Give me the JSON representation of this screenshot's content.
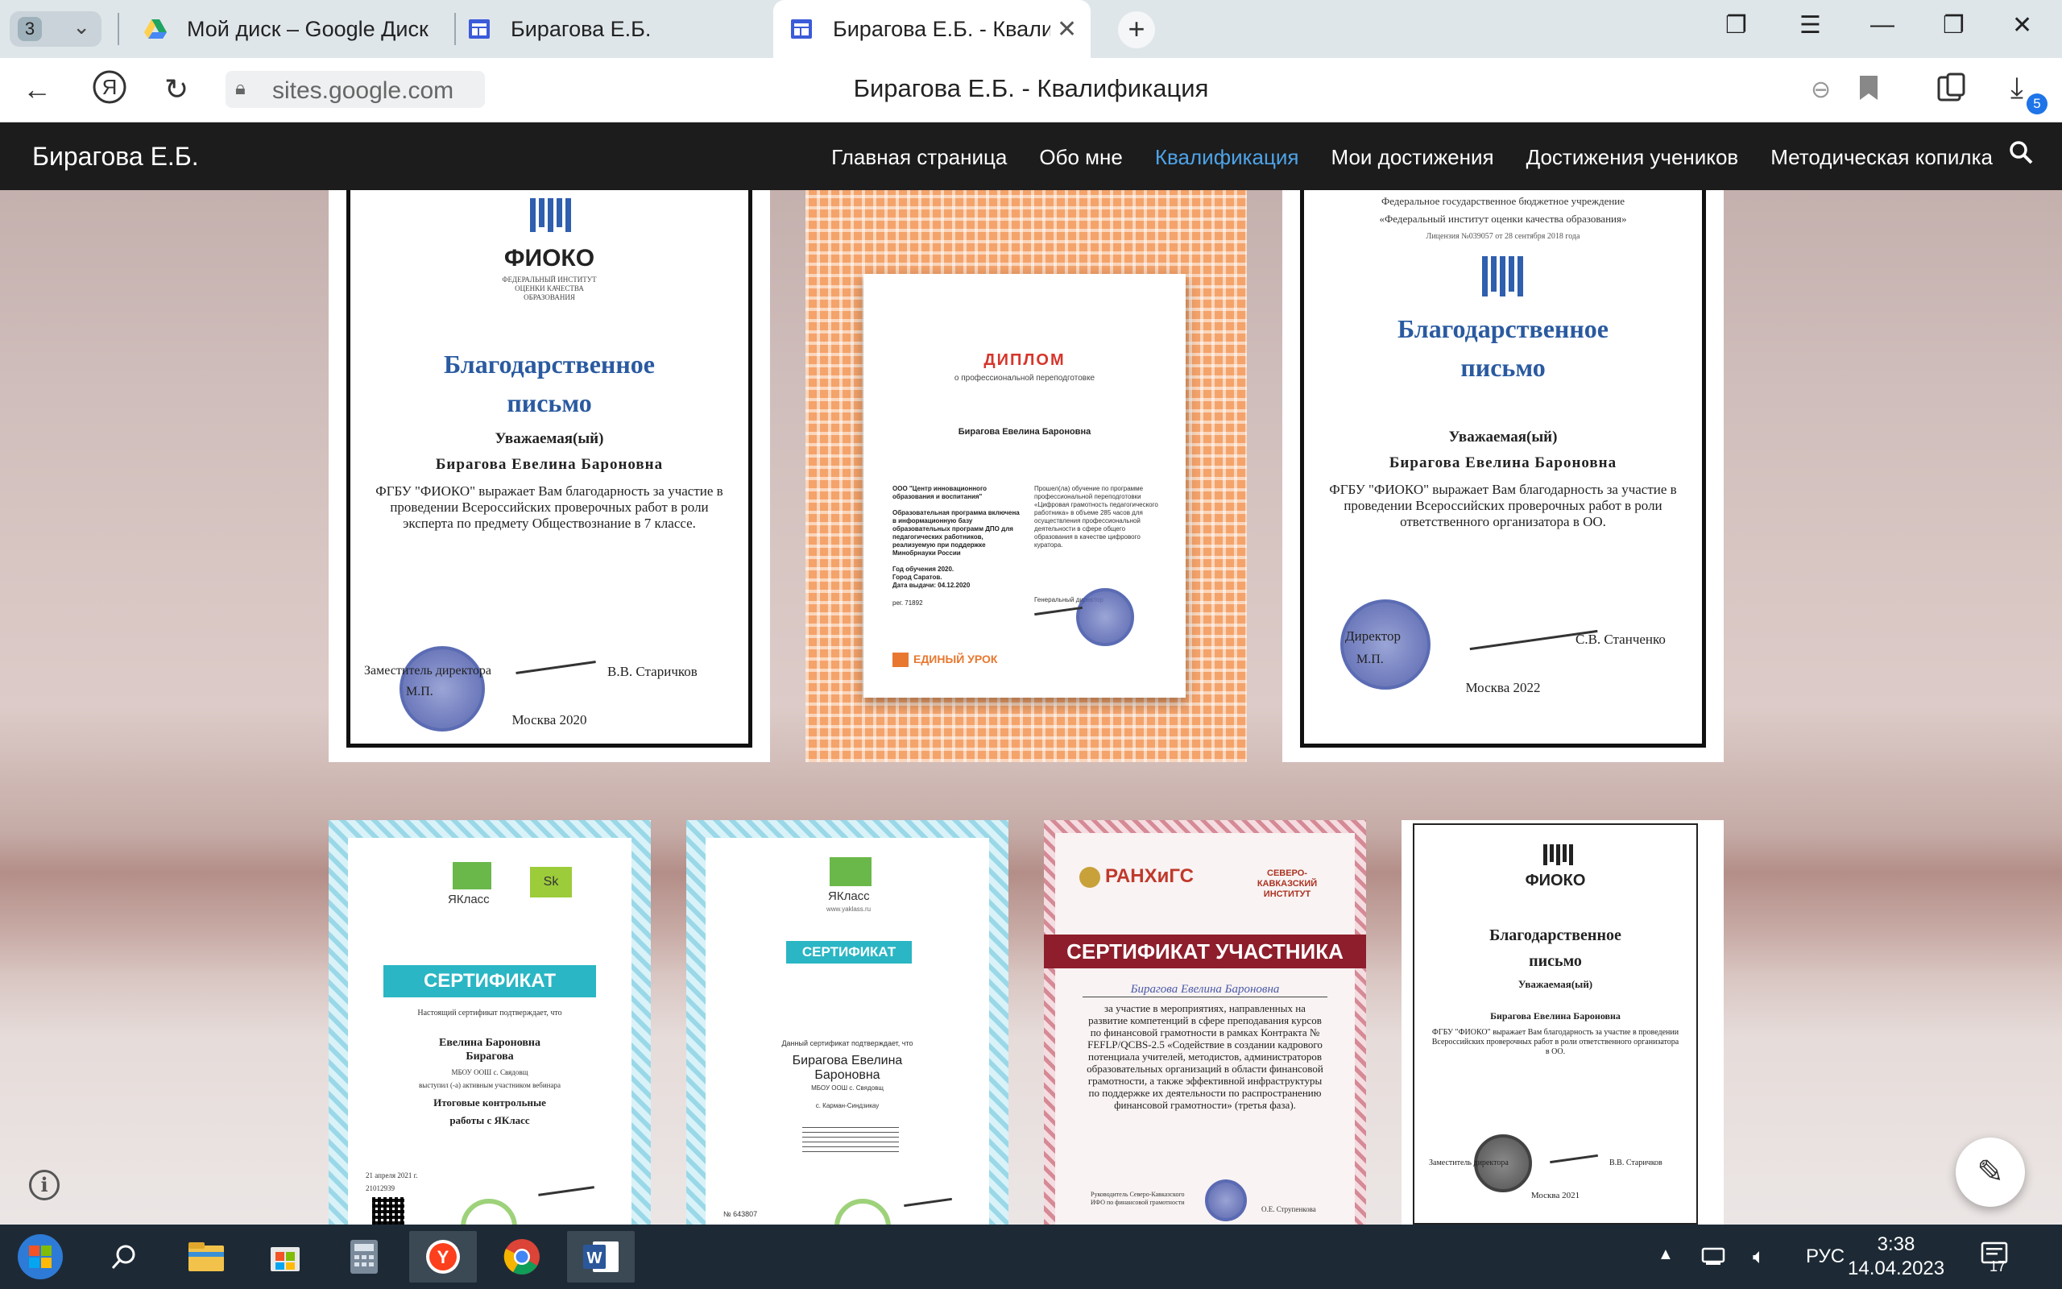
{
  "browser": {
    "tab_count": "3",
    "tabs": [
      {
        "title": "Мой диск – Google Диск",
        "icon": "google-drive-icon"
      },
      {
        "title": "Бирагова Е.Б.",
        "icon": "google-sites-icon"
      },
      {
        "title": "Бирагова Е.Б. - Квалиф",
        "icon": "google-sites-icon"
      }
    ],
    "url": "sites.google.com",
    "page_title": "Бирагова Е.Б. - Квалификация",
    "download_badge": "5"
  },
  "site": {
    "brand": "Бирагова Е.Б.",
    "nav": [
      "Главная страница",
      "Обо мне",
      "Квалификация",
      "Мои достижения",
      "Достижения учеников",
      "Методическая копилка"
    ],
    "active_nav": "Квалификация",
    "accent": "#4ea3e8"
  },
  "certs": {
    "c1": {
      "org": "ФИОКО",
      "org_sub": "ФЕДЕРАЛЬНЫЙ ИНСТИТУТ ОЦЕНКИ КАЧЕСТВА ОБРАЗОВАНИЯ",
      "title1": "Благодарственное",
      "title2": "письмо",
      "greet": "Уважаемая(ый)",
      "name": "Бирагова Евелина Бароновна",
      "body": "ФГБУ \"ФИОКО\" выражает Вам благодарность за участие в проведении Всероссийских проверочных работ в роли эксперта по предмету Обществознание в 7 классе.",
      "signer_role": "Заместитель директора",
      "signer": "В.В. Старичков",
      "mp": "М.П.",
      "place": "Москва 2020"
    },
    "c2": {
      "title": "ДИПЛОМ",
      "subtitle": "о профессиональной переподготовке",
      "name": "Бирагова Евелина Бароновна",
      "org": "ООО \"Центр инновационного образования и воспитания\"",
      "left_text": "Образовательная программа включена в информационную базу образовательных программ ДПО для педагогических работников, реализуемую при поддержке Минобрнауки России",
      "year": "Год обучения 2020.",
      "city": "Город Саратов.",
      "date": "Дата выдачи: 04.12.2020",
      "reg": "рег. 71892",
      "right_text": "Прошел(ла) обучение по программе профессиональной переподготовки «Цифровая грамотность педагогического работника» в объеме 285 часов для осуществления профессиональной деятельности в сфере общего образования в качестве цифрового куратора.",
      "sign_label": "Генеральный директор",
      "brand": "ЕДИНЫЙ УРОК"
    },
    "c3": {
      "header1": "Федеральное государственное бюджетное учреждение",
      "header2": "«Федеральный институт оценки качества образования»",
      "license": "Лицензия №039057 от 28 сентября 2018 года",
      "title1": "Благодарственное",
      "title2": "письмо",
      "greet": "Уважаемая(ый)",
      "name": "Бирагова Евелина Бароновна",
      "body": "ФГБУ \"ФИОКО\" выражает Вам благодарность за участие в проведении Всероссийских проверочных работ в роли ответственного организатора в ОО.",
      "signer_role": "Директор",
      "signer": "С.В. Станченко",
      "mp": "М.П.",
      "place": "Москва 2022"
    },
    "c4": {
      "brand": "ЯКласс",
      "brand2": "Sk",
      "title": "СЕРТИФИКАТ",
      "intro": "Настоящий сертификат подтверждает, что",
      "name": "Евелина Бароновна Бирагова",
      "school": "МБОУ ООШ с. Свядовщ",
      "role": "выступил (-а) активным участником вебинара",
      "event": "Итоговые контрольные работы с ЯКласс",
      "date": "21 апреля 2021 г.",
      "num": "21012939"
    },
    "c5": {
      "brand": "ЯКласс",
      "site": "www.yaklass.ru",
      "title": "СЕРТИФИКАТ",
      "intro": "Данный сертификат подтверждает, что",
      "name": "Бирагова Евелина Бароновна",
      "school": "МБОУ ООШ с. Свядовщ",
      "place": "с. Карман-Синдзикау",
      "num": "№ 643807"
    },
    "c6": {
      "org": "РАНХиГС",
      "branch": "СЕВЕРО-КАВКАЗСКИЙ ИНСТИТУТ",
      "title": "СЕРТИФИКАТ УЧАСТНИКА",
      "name": "Бирагова Евелина Бароновна",
      "body": "за участие в мероприятиях, направленных на развитие компетенций в сфере преподавания курсов по финансовой грамотности в рамках Контракта № FEFLP/QCBS-2.5 «Содействие в создании кадрового потенциала учителей, методистов, администраторов образовательных организаций в области финансовой грамотности, а также эффективной инфраструктуры по поддержке их деятельности по распространению финансовой грамотности» (третья фаза).",
      "signer_role": "Руководитель Северо-Кавказского ИФО по финансовой грамотности",
      "signer": "О.Е. Струпенкова"
    },
    "c7": {
      "org": "ФИОКО",
      "title1": "Благодарственное",
      "title2": "письмо",
      "greet": "Уважаемая(ый)",
      "name": "Бирагова Евелина Бароновна",
      "body": "ФГБУ \"ФИОКО\" выражает Вам благодарность за участие в проведении Всероссийских проверочных работ в роли ответственного организатора в ОО.",
      "signer_role": "Заместитель директора",
      "signer": "В.В. Старичков",
      "place": "Москва 2021"
    }
  },
  "taskbar": {
    "lang": "РУС",
    "time": "3:38",
    "date": "14.04.2023",
    "notif_count": "17",
    "bg": "#1d2a36"
  }
}
